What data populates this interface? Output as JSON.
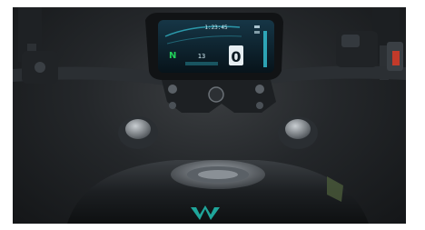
{
  "photo": {
    "subject": "motorcycle-cockpit",
    "colors": {
      "background": "#2a2d30",
      "metal": "#1a1c1e",
      "chrome": "#8a9096",
      "screen": "#0c1a22",
      "screen_accent": "#36c6d8",
      "neutral_indicator": "#22d05a",
      "logo_teal": "#1fa59a"
    }
  },
  "dashboard": {
    "clock": "1:23:45",
    "gear_indicator": "N",
    "speed": "13",
    "gear_display": "0"
  }
}
